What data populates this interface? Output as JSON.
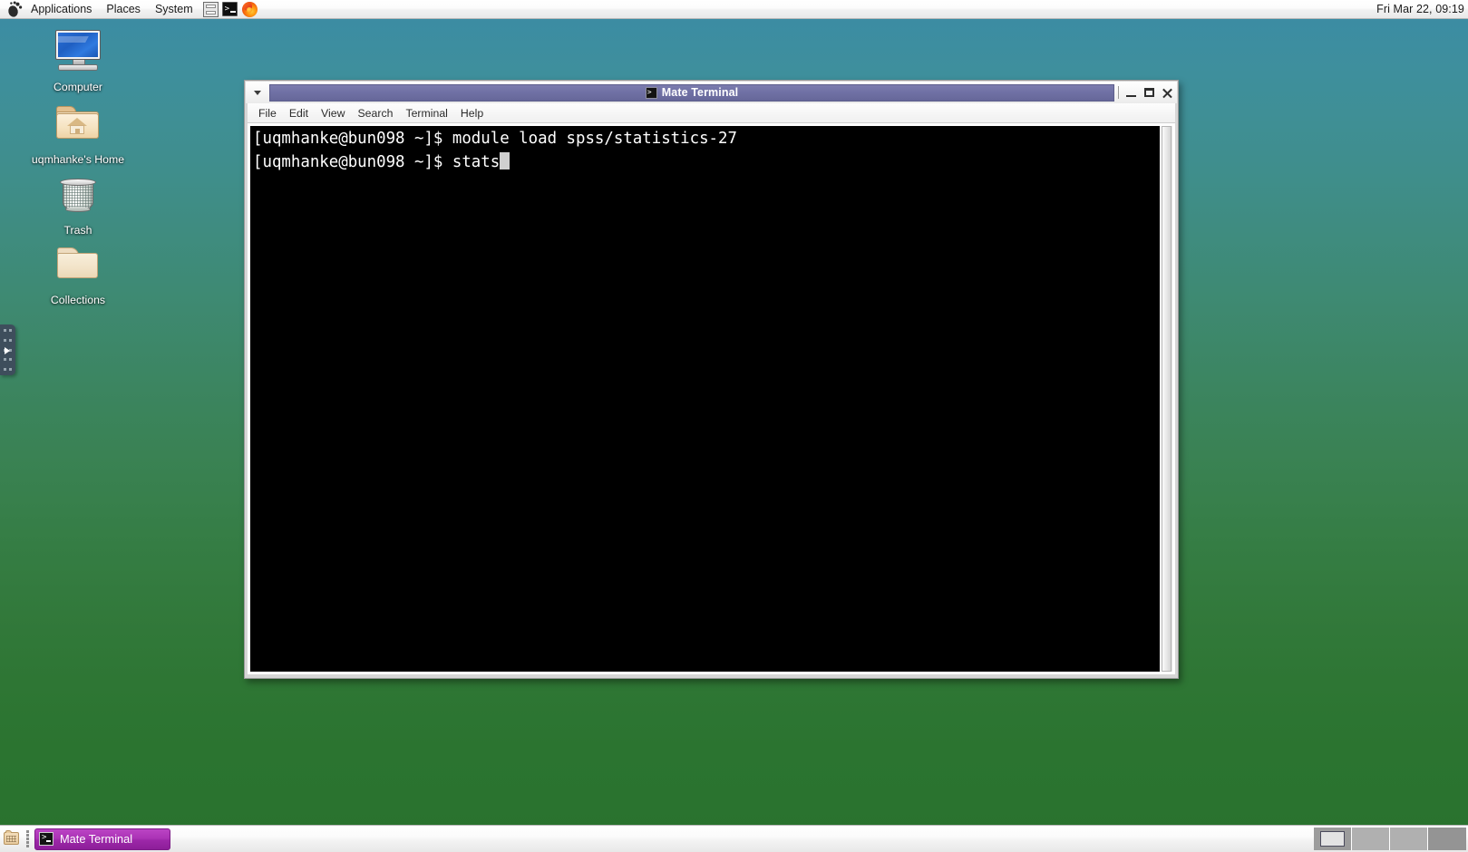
{
  "top_panel": {
    "menus": [
      {
        "label": "Applications",
        "name": "menu-applications"
      },
      {
        "label": "Places",
        "name": "menu-places"
      },
      {
        "label": "System",
        "name": "menu-system"
      }
    ],
    "launchers": [
      {
        "icon": "archive-manager-icon"
      },
      {
        "icon": "terminal-icon"
      },
      {
        "icon": "firefox-icon"
      }
    ],
    "clock": "Fri Mar 22, 09:19"
  },
  "desktop": {
    "icons": [
      {
        "label": "Computer",
        "icon": "computer-monitor-icon"
      },
      {
        "label": "uqmhanke's Home",
        "icon": "home-folder-icon"
      },
      {
        "label": "Trash",
        "icon": "trash-can-icon"
      },
      {
        "label": "Collections",
        "icon": "folder-icon"
      }
    ]
  },
  "terminal_window": {
    "title": "Mate Terminal",
    "title_icon": "terminal-icon",
    "menu": [
      {
        "label": "File"
      },
      {
        "label": "Edit"
      },
      {
        "label": "View"
      },
      {
        "label": "Search"
      },
      {
        "label": "Terminal"
      },
      {
        "label": "Help"
      }
    ],
    "window_buttons": {
      "minimize": "minimize-icon",
      "maximize": "maximize-icon",
      "close": "close-icon"
    },
    "content": {
      "line1": "[uqmhanke@bun098 ~]$ module load spss/statistics-27",
      "line2_prompt": "[uqmhanke@bun098 ~]$ stats"
    }
  },
  "bottom_panel": {
    "tasks": [
      {
        "label": "Mate Terminal",
        "icon": "terminal-icon",
        "active": true
      }
    ],
    "workspaces": [
      {
        "name": "workspace-1",
        "active": true,
        "has_window": true
      },
      {
        "name": "workspace-2",
        "active": false,
        "has_window": false
      },
      {
        "name": "workspace-3",
        "active": false,
        "has_window": false
      },
      {
        "name": "workspace-4",
        "active": false,
        "has_window": false
      }
    ]
  }
}
